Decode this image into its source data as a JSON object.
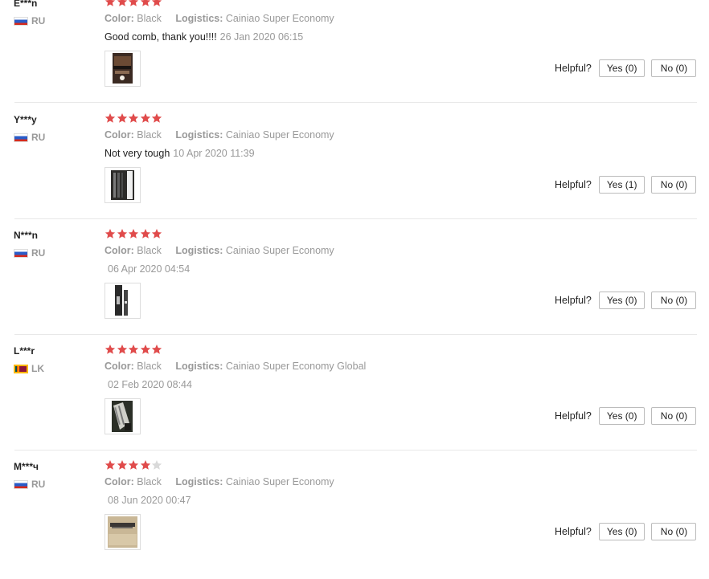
{
  "labels": {
    "color": "Color:",
    "logistics": "Logistics:",
    "helpful": "Helpful?"
  },
  "colors": {
    "star_filled": "#e04b4b",
    "star_empty": "#d9d9d9"
  },
  "reviews": [
    {
      "name": "E***n",
      "country": "RU",
      "flag": "ru-flag-icon",
      "rating": 5,
      "color": "Black",
      "logistics": "Cainiao Super Economy",
      "comment": "Good comb, thank you!!!!",
      "date": "26 Jan 2020 06:15",
      "photo": "review-photo",
      "yes": "Yes (0)",
      "no": "No (0)"
    },
    {
      "name": "Y***y",
      "country": "RU",
      "flag": "ru-flag-icon",
      "rating": 5,
      "color": "Black",
      "logistics": "Cainiao Super Economy",
      "comment": "Not very tough",
      "date": "10 Apr 2020 11:39",
      "photo": "review-photo",
      "yes": "Yes (1)",
      "no": "No (0)"
    },
    {
      "name": "N***n",
      "country": "RU",
      "flag": "ru-flag-icon",
      "rating": 5,
      "color": "Black",
      "logistics": "Cainiao Super Economy",
      "comment": "",
      "date": "06 Apr 2020 04:54",
      "photo": "review-photo",
      "yes": "Yes (0)",
      "no": "No (0)"
    },
    {
      "name": "L***r",
      "country": "LK",
      "flag": "lk-flag-icon",
      "rating": 5,
      "color": "Black",
      "logistics": "Cainiao Super Economy Global",
      "comment": "",
      "date": "02 Feb 2020 08:44",
      "photo": "review-photo",
      "yes": "Yes (0)",
      "no": "No (0)"
    },
    {
      "name": "M***ч",
      "country": "RU",
      "flag": "ru-flag-icon",
      "rating": 4,
      "color": "Black",
      "logistics": "Cainiao Super Economy",
      "comment": "",
      "date": "08 Jun 2020 00:47",
      "photo": "review-photo",
      "yes": "Yes (0)",
      "no": "No (0)"
    }
  ]
}
